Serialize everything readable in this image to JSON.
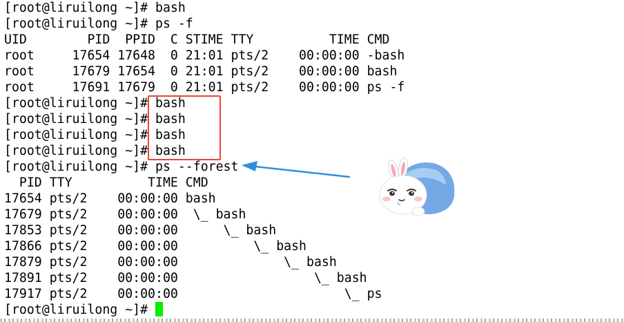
{
  "terminal": {
    "lines": [
      "[root@liruilong ~]# bash",
      "[root@liruilong ~]# ps -f",
      "UID        PID  PPID  C STIME TTY          TIME CMD",
      "root     17654 17648  0 21:01 pts/2    00:00:00 -bash",
      "root     17679 17654  0 21:01 pts/2    00:00:00 bash",
      "root     17691 17679  0 21:01 pts/2    00:00:00 ps -f",
      "[root@liruilong ~]# bash",
      "[root@liruilong ~]# bash",
      "[root@liruilong ~]# bash",
      "[root@liruilong ~]# bash",
      "[root@liruilong ~]# ps --forest",
      "  PID TTY          TIME CMD",
      "17654 pts/2    00:00:00 bash",
      "17679 pts/2    00:00:00  \\_ bash",
      "17853 pts/2    00:00:00      \\_ bash",
      "17866 pts/2    00:00:00          \\_ bash",
      "17879 pts/2    00:00:00              \\_ bash",
      "17891 pts/2    00:00:00                  \\_ bash",
      "17917 pts/2    00:00:00                      \\_ ps"
    ],
    "prompt": "[root@liruilong ~]# "
  },
  "colors": {
    "background": "#ffffff",
    "text": "#000000",
    "cursor": "#00ee00",
    "highlight_box": "#e8453c",
    "arrow": "#2f8ee0"
  },
  "annotations": {
    "highlight_box": "red-rectangle",
    "arrow": "blue-arrow",
    "sticker": "bunny-sticker"
  }
}
